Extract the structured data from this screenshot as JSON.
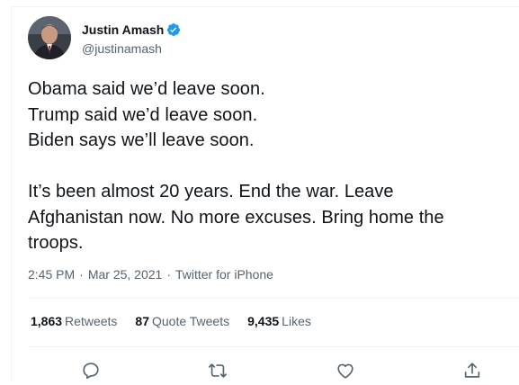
{
  "author": {
    "display_name": "Justin Amash",
    "handle": "@justinamash",
    "verified": true,
    "avatar_icon": "profile-photo"
  },
  "tweet": {
    "lines": [
      "Obama said we’d leave soon.",
      "Trump said we’d leave soon.",
      "Biden says we’ll leave soon."
    ],
    "paragraph2": [
      "It’s been almost 20 years. End the war. Leave",
      "Afghanistan now. No more excuses. Bring home the",
      "troops."
    ]
  },
  "meta": {
    "time": "2:45 PM",
    "separator": "·",
    "date": "Mar 25, 2021",
    "source": "Twitter for iPhone"
  },
  "stats": {
    "retweets_count": "1,863",
    "retweets_label": "Retweets",
    "quotes_count": "87",
    "quotes_label": "Quote Tweets",
    "likes_count": "9,435",
    "likes_label": "Likes"
  },
  "actions": {
    "reply_icon": "reply-icon",
    "retweet_icon": "retweet-icon",
    "like_icon": "heart-icon",
    "share_icon": "share-icon"
  },
  "colors": {
    "text": "#0f1419",
    "secondary": "#536471",
    "verified_blue": "#1d9bf0",
    "divider": "#eff3f4"
  }
}
